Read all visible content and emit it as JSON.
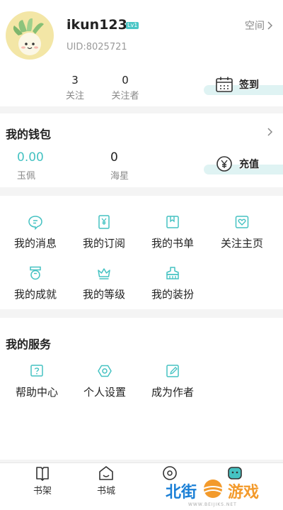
{
  "profile": {
    "username": "ikun123",
    "level_badge": "Lv1",
    "uid": "UID:8025721",
    "space_label": "空间",
    "stats": [
      {
        "value": "3",
        "label": "关注"
      },
      {
        "value": "0",
        "label": "关注者"
      }
    ],
    "checkin_label": "签到"
  },
  "wallet": {
    "title": "我的钱包",
    "items": [
      {
        "value": "0.00",
        "label": "玉佩"
      },
      {
        "value": "0",
        "label": "海星"
      }
    ],
    "recharge_label": "充值"
  },
  "features": [
    {
      "label": "我的消息",
      "icon": "message-icon"
    },
    {
      "label": "我的订阅",
      "icon": "subscription-icon"
    },
    {
      "label": "我的书单",
      "icon": "booklist-icon"
    },
    {
      "label": "关注主页",
      "icon": "heart-icon"
    },
    {
      "label": "我的成就",
      "icon": "medal-icon"
    },
    {
      "label": "我的等级",
      "icon": "crown-icon"
    },
    {
      "label": "我的装扮",
      "icon": "dressup-icon"
    }
  ],
  "services": {
    "title": "我的服务",
    "items": [
      {
        "label": "帮助中心",
        "icon": "help-icon"
      },
      {
        "label": "个人设置",
        "icon": "settings-icon"
      },
      {
        "label": "成为作者",
        "icon": "author-icon"
      }
    ]
  },
  "bottom_nav": [
    {
      "label": "书架",
      "icon": "bookshelf-icon"
    },
    {
      "label": "书城",
      "icon": "bookstore-icon"
    }
  ],
  "watermark": {
    "text_left": "北街",
    "text_right": "游戏",
    "sub": "WWW.BEIJIKS.NET"
  },
  "colors": {
    "accent": "#45c2c2",
    "accent_light": "#dff3f3",
    "watermark_blue": "#1a7fd6",
    "watermark_orange": "#f39a2b"
  }
}
